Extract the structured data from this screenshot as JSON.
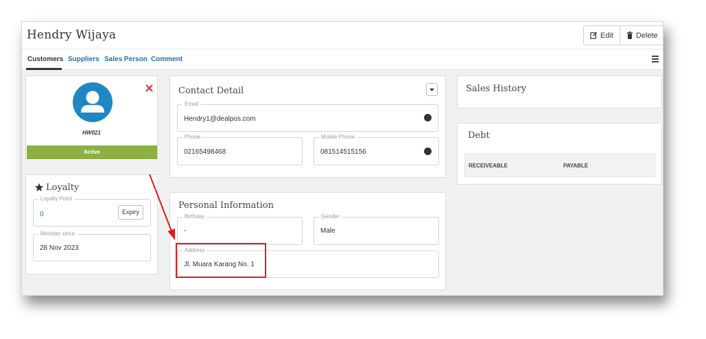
{
  "header": {
    "title": "Hendry Wijaya",
    "edit_label": "Edit",
    "delete_label": "Delete"
  },
  "tabs": [
    {
      "label": "Customers",
      "active": true
    },
    {
      "label": "Suppliers",
      "active": false
    },
    {
      "label": "Sales Person",
      "active": false
    },
    {
      "label": "Comment",
      "active": false
    }
  ],
  "profile": {
    "code": "HW021",
    "status": "Active",
    "status_color": "#8bb043",
    "avatar_color": "#1e87c4",
    "close_color": "#d9383a"
  },
  "loyalty": {
    "title": "Loyalty",
    "point_label": "Loyalty Point",
    "point_value": "0",
    "expiry_label": "Expiry",
    "member_since_label": "Member since",
    "member_since_value": "28 Nov 2023"
  },
  "contact": {
    "title": "Contact Detail",
    "email_label": "Email",
    "email_value": "Hendry1@dealpos.com",
    "phone_label": "Phone",
    "phone_value": "02165498468",
    "mobile_label": "Mobile Phone",
    "mobile_value": "081514515156"
  },
  "personal": {
    "title": "Personal Information",
    "birthday_label": "Birthday",
    "birthday_value": "-",
    "gender_label": "Gender",
    "gender_value": "Male",
    "address_label": "Address",
    "address_value": "Jl. Muara Karang No. 1"
  },
  "sales_history": {
    "title": "Sales History"
  },
  "debt": {
    "title": "Debt",
    "col_receivable": "RECEIVEABLE",
    "col_payable": "PAYABLE"
  },
  "annotation": {
    "color": "#e01b1b"
  }
}
